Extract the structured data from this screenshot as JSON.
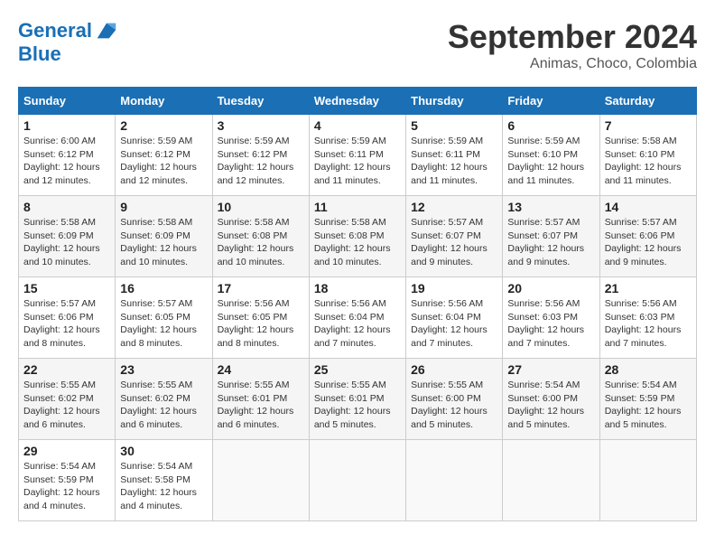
{
  "header": {
    "logo_line1": "General",
    "logo_line2": "Blue",
    "month": "September 2024",
    "location": "Animas, Choco, Colombia"
  },
  "days_of_week": [
    "Sunday",
    "Monday",
    "Tuesday",
    "Wednesday",
    "Thursday",
    "Friday",
    "Saturday"
  ],
  "weeks": [
    [
      {
        "day": "1",
        "text": "Sunrise: 6:00 AM\nSunset: 6:12 PM\nDaylight: 12 hours\nand 12 minutes."
      },
      {
        "day": "2",
        "text": "Sunrise: 5:59 AM\nSunset: 6:12 PM\nDaylight: 12 hours\nand 12 minutes."
      },
      {
        "day": "3",
        "text": "Sunrise: 5:59 AM\nSunset: 6:12 PM\nDaylight: 12 hours\nand 12 minutes."
      },
      {
        "day": "4",
        "text": "Sunrise: 5:59 AM\nSunset: 6:11 PM\nDaylight: 12 hours\nand 11 minutes."
      },
      {
        "day": "5",
        "text": "Sunrise: 5:59 AM\nSunset: 6:11 PM\nDaylight: 12 hours\nand 11 minutes."
      },
      {
        "day": "6",
        "text": "Sunrise: 5:59 AM\nSunset: 6:10 PM\nDaylight: 12 hours\nand 11 minutes."
      },
      {
        "day": "7",
        "text": "Sunrise: 5:58 AM\nSunset: 6:10 PM\nDaylight: 12 hours\nand 11 minutes."
      }
    ],
    [
      {
        "day": "8",
        "text": "Sunrise: 5:58 AM\nSunset: 6:09 PM\nDaylight: 12 hours\nand 10 minutes."
      },
      {
        "day": "9",
        "text": "Sunrise: 5:58 AM\nSunset: 6:09 PM\nDaylight: 12 hours\nand 10 minutes."
      },
      {
        "day": "10",
        "text": "Sunrise: 5:58 AM\nSunset: 6:08 PM\nDaylight: 12 hours\nand 10 minutes."
      },
      {
        "day": "11",
        "text": "Sunrise: 5:58 AM\nSunset: 6:08 PM\nDaylight: 12 hours\nand 10 minutes."
      },
      {
        "day": "12",
        "text": "Sunrise: 5:57 AM\nSunset: 6:07 PM\nDaylight: 12 hours\nand 9 minutes."
      },
      {
        "day": "13",
        "text": "Sunrise: 5:57 AM\nSunset: 6:07 PM\nDaylight: 12 hours\nand 9 minutes."
      },
      {
        "day": "14",
        "text": "Sunrise: 5:57 AM\nSunset: 6:06 PM\nDaylight: 12 hours\nand 9 minutes."
      }
    ],
    [
      {
        "day": "15",
        "text": "Sunrise: 5:57 AM\nSunset: 6:06 PM\nDaylight: 12 hours\nand 8 minutes."
      },
      {
        "day": "16",
        "text": "Sunrise: 5:57 AM\nSunset: 6:05 PM\nDaylight: 12 hours\nand 8 minutes."
      },
      {
        "day": "17",
        "text": "Sunrise: 5:56 AM\nSunset: 6:05 PM\nDaylight: 12 hours\nand 8 minutes."
      },
      {
        "day": "18",
        "text": "Sunrise: 5:56 AM\nSunset: 6:04 PM\nDaylight: 12 hours\nand 7 minutes."
      },
      {
        "day": "19",
        "text": "Sunrise: 5:56 AM\nSunset: 6:04 PM\nDaylight: 12 hours\nand 7 minutes."
      },
      {
        "day": "20",
        "text": "Sunrise: 5:56 AM\nSunset: 6:03 PM\nDaylight: 12 hours\nand 7 minutes."
      },
      {
        "day": "21",
        "text": "Sunrise: 5:56 AM\nSunset: 6:03 PM\nDaylight: 12 hours\nand 7 minutes."
      }
    ],
    [
      {
        "day": "22",
        "text": "Sunrise: 5:55 AM\nSunset: 6:02 PM\nDaylight: 12 hours\nand 6 minutes."
      },
      {
        "day": "23",
        "text": "Sunrise: 5:55 AM\nSunset: 6:02 PM\nDaylight: 12 hours\nand 6 minutes."
      },
      {
        "day": "24",
        "text": "Sunrise: 5:55 AM\nSunset: 6:01 PM\nDaylight: 12 hours\nand 6 minutes."
      },
      {
        "day": "25",
        "text": "Sunrise: 5:55 AM\nSunset: 6:01 PM\nDaylight: 12 hours\nand 5 minutes."
      },
      {
        "day": "26",
        "text": "Sunrise: 5:55 AM\nSunset: 6:00 PM\nDaylight: 12 hours\nand 5 minutes."
      },
      {
        "day": "27",
        "text": "Sunrise: 5:54 AM\nSunset: 6:00 PM\nDaylight: 12 hours\nand 5 minutes."
      },
      {
        "day": "28",
        "text": "Sunrise: 5:54 AM\nSunset: 5:59 PM\nDaylight: 12 hours\nand 5 minutes."
      }
    ],
    [
      {
        "day": "29",
        "text": "Sunrise: 5:54 AM\nSunset: 5:59 PM\nDaylight: 12 hours\nand 4 minutes."
      },
      {
        "day": "30",
        "text": "Sunrise: 5:54 AM\nSunset: 5:58 PM\nDaylight: 12 hours\nand 4 minutes."
      },
      {
        "day": "",
        "text": ""
      },
      {
        "day": "",
        "text": ""
      },
      {
        "day": "",
        "text": ""
      },
      {
        "day": "",
        "text": ""
      },
      {
        "day": "",
        "text": ""
      }
    ]
  ]
}
